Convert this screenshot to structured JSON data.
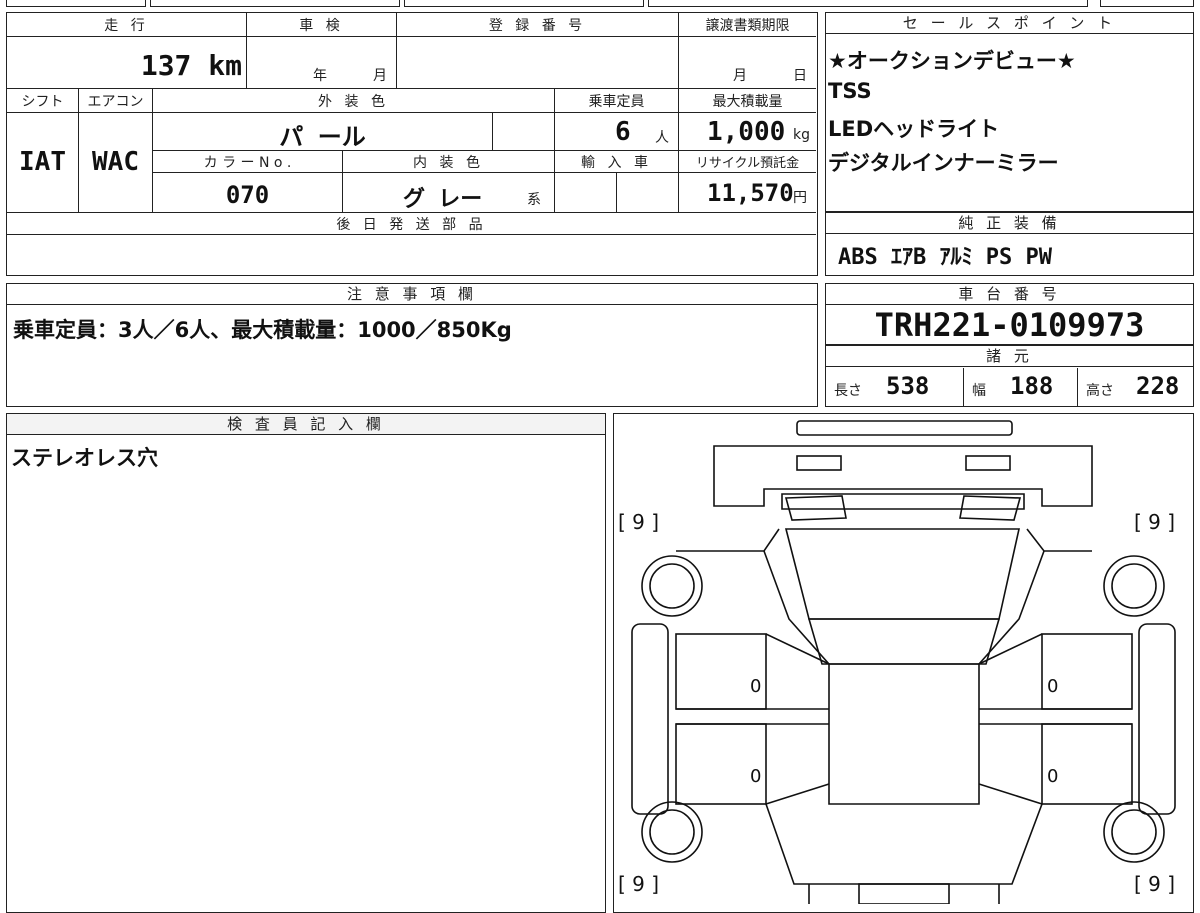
{
  "top_strip": [
    "",
    "",
    "",
    ""
  ],
  "main_table": {
    "mileage_label": "走 行",
    "mileage_value": "137",
    "mileage_unit": "km",
    "inspection_label": "車 検",
    "inspection_year": "年",
    "inspection_month": "月",
    "registration_label": "登 録 番 号",
    "transfer_label": "譲渡書類期限",
    "transfer_month": "月",
    "transfer_day": "日",
    "shift_label": "シフト",
    "shift_value": "IAT",
    "ac_label": "エアコン",
    "ac_value": "WAC",
    "exterior_label": "外 装 色",
    "exterior_value": "パ ール",
    "capacity_label": "乗車定員",
    "capacity_value": "6",
    "capacity_unit": "人",
    "max_load_label": "最大積載量",
    "max_load_value": "1,000",
    "max_load_unit": "kg",
    "color_no_label": "カ ラ ー N o .",
    "color_no_value": "070",
    "interior_label": "内 装 色",
    "interior_value": "グ レー",
    "interior_suffix": "系",
    "import_label": "輸 入 車",
    "recycle_label": "リサイクル預託金",
    "recycle_value": "11,570",
    "recycle_unit": "円",
    "later_parts_label": "後 日 発 送 部 品"
  },
  "sales_points": {
    "header": "セ ー ル ス ポ イ ン ト",
    "items": [
      "★オークションデビュー★",
      "TSS",
      "LEDヘッドライト",
      "デジタルインナーミラー"
    ]
  },
  "standard_equipment": {
    "header": "純 正 装 備",
    "value": "ABS ｴｱB ｱﾙﾐ PS PW"
  },
  "notes": {
    "header": "注 意 事 項 欄",
    "text": "乗車定員：3人／6人、最大積載量：1000／850Kg"
  },
  "chassis": {
    "header": "車 台 番 号",
    "value": "TRH221-0109973"
  },
  "specs": {
    "header": "諸 元",
    "length_label": "長さ",
    "length_value": "538",
    "width_label": "幅",
    "width_value": "188",
    "height_label": "高さ",
    "height_value": "228"
  },
  "inspector": {
    "header": "検 査 員 記 入 欄",
    "text": "ステレオレス穴"
  },
  "diagram": {
    "tire_tl": "[ 9 ]",
    "tire_tr": "[ 9 ]",
    "tire_bl": "[ 9 ]",
    "tire_br": "[ 9 ]",
    "door_mark_1": "0",
    "door_mark_2": "0",
    "door_mark_3": "0",
    "door_mark_4": "0"
  }
}
